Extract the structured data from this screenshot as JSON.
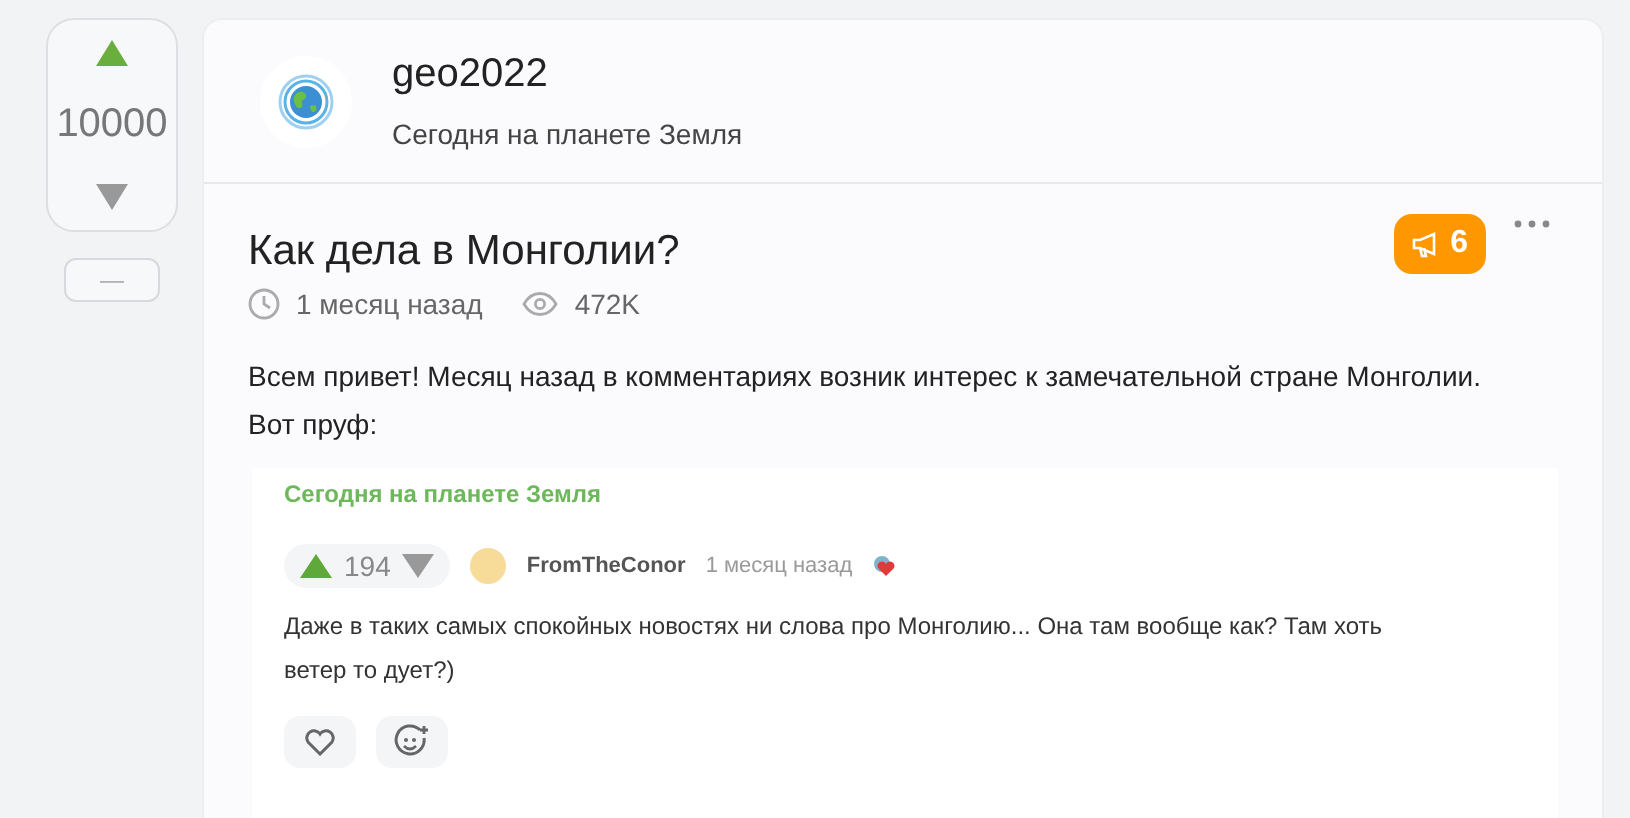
{
  "vote": {
    "score": "10000",
    "minus": "—"
  },
  "community": {
    "name": "geo2022",
    "subtitle": "Сегодня на планете Земля"
  },
  "post": {
    "title": "Как дела в Монголии?",
    "time": "1 месяц назад",
    "views": "472K",
    "badge": "6",
    "paragraphs": [
      "Всем привет! Месяц назад в комментариях возник интерес к замечательной стране Монголии.",
      "Вот пруф:"
    ]
  },
  "embedded": {
    "community": "Сегодня на планете Земля",
    "comment": {
      "rating": "194",
      "author": "FromTheConor",
      "time": "1 месяц назад",
      "text": "Даже в таких самых спокойных новостях ни слова про Монголию... Она там вообще как? Там хоть ветер то дует?)"
    }
  }
}
